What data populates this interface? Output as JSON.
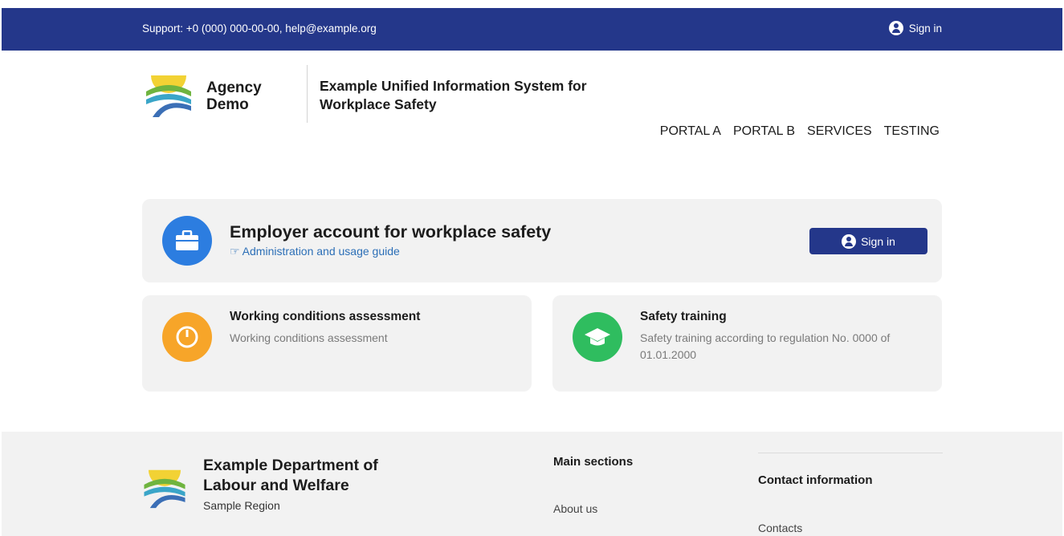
{
  "topbar": {
    "support": "Support: +0 (000) 000-00-00, help@example.org",
    "login_label": "Sign in"
  },
  "header": {
    "logo_line1": "Agency",
    "logo_line2": "Demo",
    "site_title": "Example Unified Information System for Workplace Safety"
  },
  "nav": [
    "PORTAL A",
    "PORTAL B",
    "SERVICES",
    "TESTING"
  ],
  "hero": {
    "title": "Employer account for workplace safety",
    "link": "☞ Administration and usage guide",
    "button": "Sign in"
  },
  "cards": [
    {
      "title": "Working conditions assessment",
      "desc": "Working conditions assessment",
      "color": "#f7a529"
    },
    {
      "title": "Safety training",
      "desc": "Safety training according to regulation No. 0000 of 01.01.2000",
      "color": "#2fbd5f"
    }
  ],
  "footer": {
    "name_line1": "Example Department of",
    "name_line2": "Labour and Welfare",
    "subtitle": "Sample Region",
    "col1_heading": "Main sections",
    "col1_link": "About us",
    "col2_heading": "Contact information",
    "col2_link": "Contacts"
  },
  "colors": {
    "primary": "#24378a",
    "accent_blue": "#2c7de0"
  }
}
